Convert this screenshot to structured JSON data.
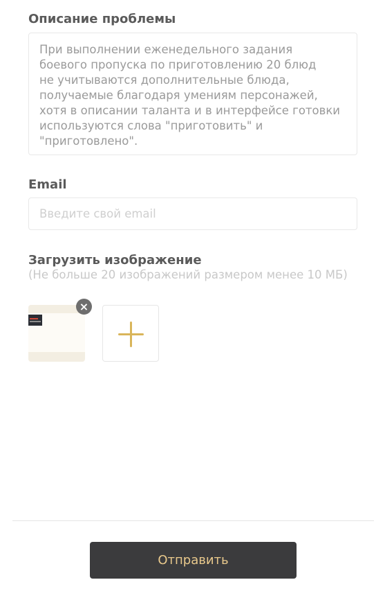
{
  "problem": {
    "title": "Описание проблемы",
    "text": "При выполнении еженедельного задания\nбоевого пропуска по приготовлению 20 блюд\nне учитываются дополнительные блюда,\nполучаемые благодаря умениям персонажей,\nхотя в описании таланта и в интерфейсе готовки\nиспользуются слова \"приготовить\" и\n\"приготовлено\"."
  },
  "email": {
    "title": "Email",
    "placeholder": "Введите свой email",
    "value": ""
  },
  "upload": {
    "title": "Загрузить изображение",
    "hint": "(Не больше 20 изображений размером менее 10 МБ)",
    "remove_label": "×",
    "images_count": 1
  },
  "submit": {
    "label": "Отправить"
  },
  "colors": {
    "accent": "#d9b55a",
    "button_bg": "#3b3b3d",
    "button_text": "#e9c98c"
  },
  "icons": {
    "remove": "close-icon",
    "add": "plus-icon"
  }
}
